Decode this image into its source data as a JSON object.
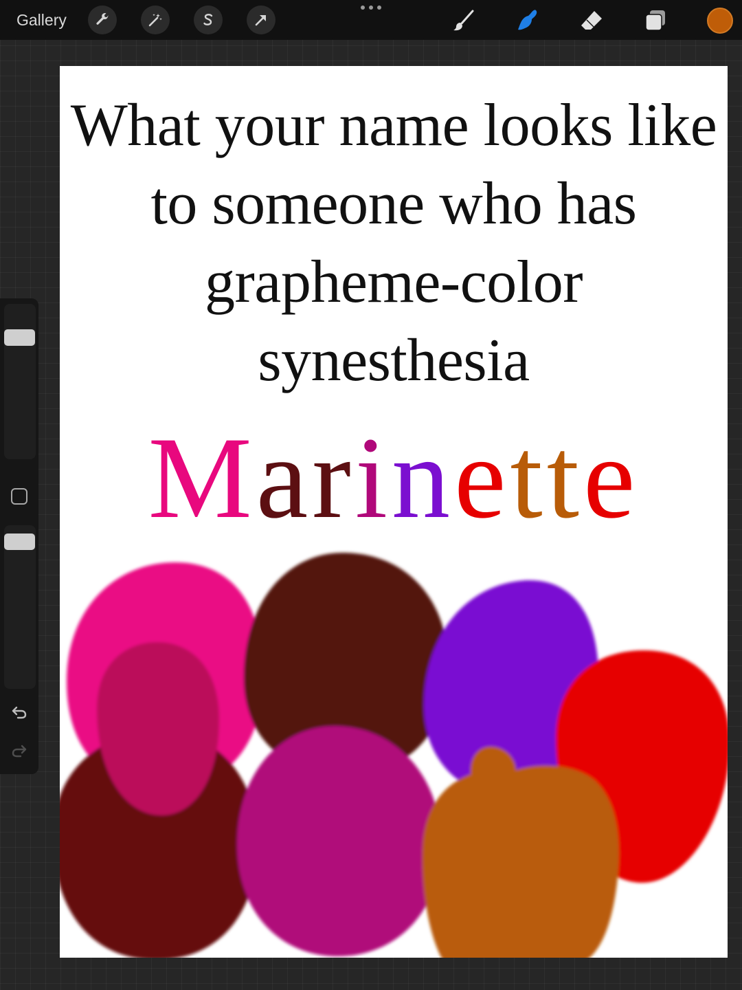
{
  "toolbar": {
    "gallery_label": "Gallery",
    "left_tools": [
      {
        "name": "actions",
        "icon": "wrench-icon"
      },
      {
        "name": "adjustments",
        "icon": "magic-wand-icon"
      },
      {
        "name": "selection",
        "icon": "selection-s-icon"
      },
      {
        "name": "transform",
        "icon": "arrow-icon"
      }
    ],
    "right_tools": [
      {
        "name": "paint",
        "icon": "brush-icon",
        "active": false
      },
      {
        "name": "smudge",
        "icon": "smudge-finger-icon",
        "active": true
      },
      {
        "name": "erase",
        "icon": "eraser-icon",
        "active": false
      },
      {
        "name": "layers",
        "icon": "layers-icon",
        "active": false
      }
    ],
    "current_color": "#bf5d08"
  },
  "sidebar": {
    "brush_size_level": 0.95,
    "opacity_level": 0.95,
    "modify_icon": "square-icon",
    "undo_icon": "undo-icon",
    "redo_icon": "redo-icon"
  },
  "canvas": {
    "heading_lines": [
      "What your name looks like",
      "to someone who has",
      "grapheme-color",
      "synesthesia"
    ],
    "name_letters": [
      {
        "char": "M",
        "color": "#e8087e"
      },
      {
        "char": "a",
        "color": "#5c0f12"
      },
      {
        "char": "r",
        "color": "#5c0f12"
      },
      {
        "char": "i",
        "color": "#b0087a"
      },
      {
        "char": "n",
        "color": "#7b0fd0"
      },
      {
        "char": "e",
        "color": "#e60000"
      },
      {
        "char": "t",
        "color": "#b85c08"
      },
      {
        "char": "t",
        "color": "#b85c08"
      },
      {
        "char": "e",
        "color": "#e60000"
      }
    ],
    "swatch_colors": {
      "pink": "#ea0a84",
      "dark_brown": "#52130f",
      "purple": "#7a0ad2",
      "red": "#e60606",
      "maroon": "#650a0e",
      "magenta": "#b0087a",
      "raspberry": "#bb0a5a",
      "orange": "#b95c07"
    }
  }
}
